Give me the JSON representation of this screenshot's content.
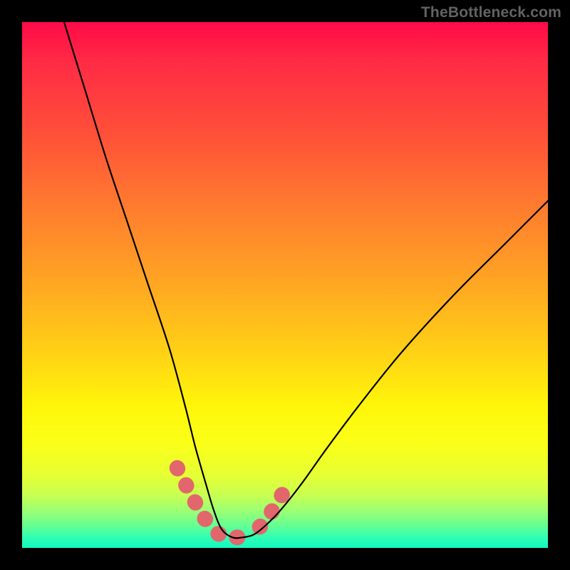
{
  "watermark": "TheBottleneck.com",
  "chart_data": {
    "type": "line",
    "title": "",
    "xlabel": "",
    "ylabel": "",
    "xlim": [
      0,
      100
    ],
    "ylim": [
      0,
      100
    ],
    "grid": false,
    "legend": false,
    "background": "rainbow-vertical-gradient",
    "series": [
      {
        "name": "bottleneck-curve",
        "x": [
          8,
          12,
          16,
          20,
          24,
          28,
          31,
          33,
          35,
          36.5,
          38,
          40,
          42,
          44,
          46,
          49,
          53,
          58,
          64,
          72,
          82,
          92,
          100
        ],
        "y": [
          100,
          87,
          74,
          62,
          50,
          38,
          27,
          19,
          12,
          7,
          3.5,
          2,
          2,
          2.5,
          4,
          7,
          12,
          19,
          27,
          37,
          48,
          58,
          66
        ],
        "stroke": "#000000",
        "stroke_width": 2
      },
      {
        "name": "highlight-left",
        "x": [
          29.5,
          31,
          32.3,
          33.5,
          34.6,
          35.6,
          36.5
        ],
        "y": [
          15.2,
          12.3,
          9.8,
          7.6,
          5.8,
          4.4,
          3.4
        ],
        "stroke": "#e2676c",
        "stroke_width": 14,
        "dash": true
      },
      {
        "name": "highlight-bottom",
        "x": [
          37.3,
          38.5,
          39.8,
          41,
          42.2,
          43.5
        ],
        "y": [
          2.7,
          2.2,
          2.0,
          2.0,
          2.1,
          2.5
        ],
        "stroke": "#e2676c",
        "stroke_width": 14,
        "dash": true
      },
      {
        "name": "highlight-right",
        "x": [
          45.2,
          46.3,
          47.4,
          48.5,
          49.5
        ],
        "y": [
          4.0,
          5.3,
          6.8,
          8.5,
          10.2
        ],
        "stroke": "#e2676c",
        "stroke_width": 14,
        "dash": true
      }
    ]
  }
}
